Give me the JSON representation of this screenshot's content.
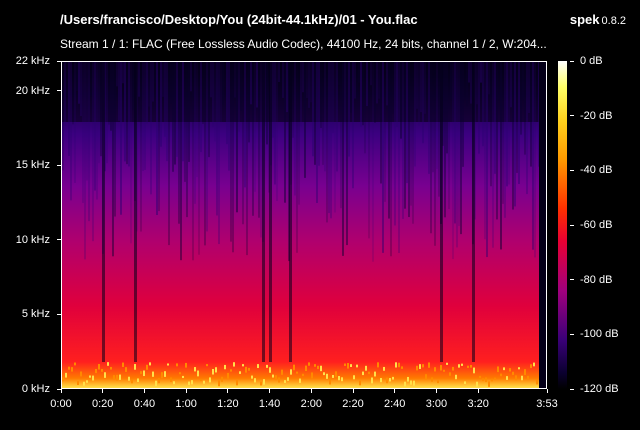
{
  "header": {
    "file_title": "/Users/francisco/Desktop/You (24bit-44.1kHz)/01 - You.flac",
    "app_name": "spek",
    "app_version": "0.8.2",
    "stream_info": "Stream 1 / 1: FLAC (Free Lossless Audio Codec), 44100 Hz, 24 bits, channel 1 / 2, W:204..."
  },
  "frequency_axis": {
    "labels": [
      "22 kHz",
      "20 kHz",
      "15 kHz",
      "10 kHz",
      "5 kHz",
      "0 kHz"
    ],
    "values_khz": [
      22,
      20,
      15,
      10,
      5,
      0
    ]
  },
  "time_axis": {
    "labels": [
      "0:00",
      "0:20",
      "0:40",
      "1:00",
      "1:20",
      "1:40",
      "2:00",
      "2:20",
      "2:40",
      "3:00",
      "3:20",
      "3:53"
    ],
    "values_sec": [
      0,
      20,
      40,
      60,
      80,
      100,
      120,
      140,
      160,
      180,
      200,
      233
    ]
  },
  "level_legend": {
    "labels": [
      "0 dB",
      "-20 dB",
      "-40 dB",
      "-60 dB",
      "-80 dB",
      "-100 dB",
      "-120 dB"
    ],
    "values_db": [
      0,
      -20,
      -40,
      -60,
      -80,
      -100,
      -120
    ]
  },
  "colors": {
    "background": "#000000",
    "text": "#ffffff",
    "spectrum_low": "#06001a",
    "spectrum_mid": "#7a0090",
    "spectrum_high": "#ff2a00",
    "spectrum_peak": "#ffd23a"
  }
}
